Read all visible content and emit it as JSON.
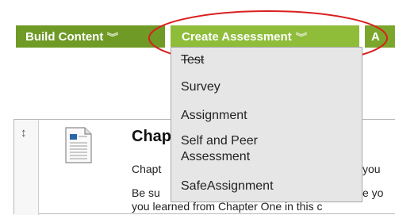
{
  "toolbar": {
    "build_content": "Build Content",
    "create_assessment": "Create Assessment",
    "partial_next": "A"
  },
  "dropdown": {
    "items": [
      "Test",
      "Survey",
      "Assignment",
      "Self and Peer\nAssessment",
      "SafeAssignment"
    ]
  },
  "content": {
    "title": "Chap",
    "line1": "Chapt",
    "line1_right": "you",
    "line2": "Be su",
    "line2_right": "e yo",
    "line3": "you learned from Chapter One in this c"
  },
  "colors": {
    "build_bg": "#6f9a26",
    "create_bg": "#8fbd3a",
    "highlight": "#d91f1f"
  },
  "icons": {
    "chevron": "double-chevron-down-icon",
    "drag": "vertical-resize-icon",
    "document": "document-icon"
  }
}
